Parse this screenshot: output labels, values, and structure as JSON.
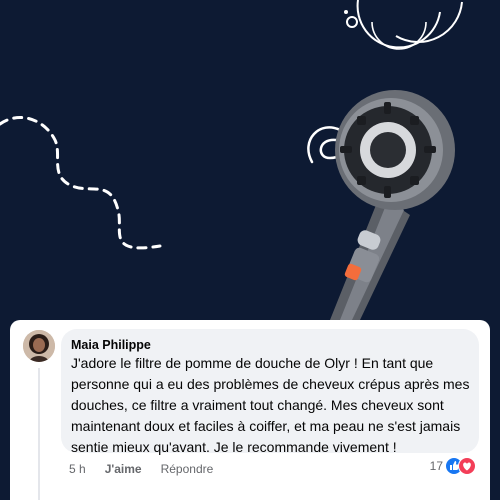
{
  "comment": {
    "author": "Maia Philippe",
    "text": "J'adore le filtre de pomme de douche de Olyr ! En tant que personne qui a eu des problèmes de cheveux crépus après mes douches, ce filtre a vraiment tout changé. Mes cheveux sont maintenant doux et faciles à coiffer, et ma peau ne s'est jamais sentie mieux qu'avant. Je le recommande vivement !",
    "time": "5 h",
    "like_label": "J'aime",
    "reply_label": "Répondre",
    "reaction_count": "17",
    "reactions": [
      "like-icon",
      "love-icon"
    ]
  },
  "colors": {
    "background": "#0d1a33",
    "like_blue": "#1877f2",
    "love_red": "#f33e58"
  }
}
